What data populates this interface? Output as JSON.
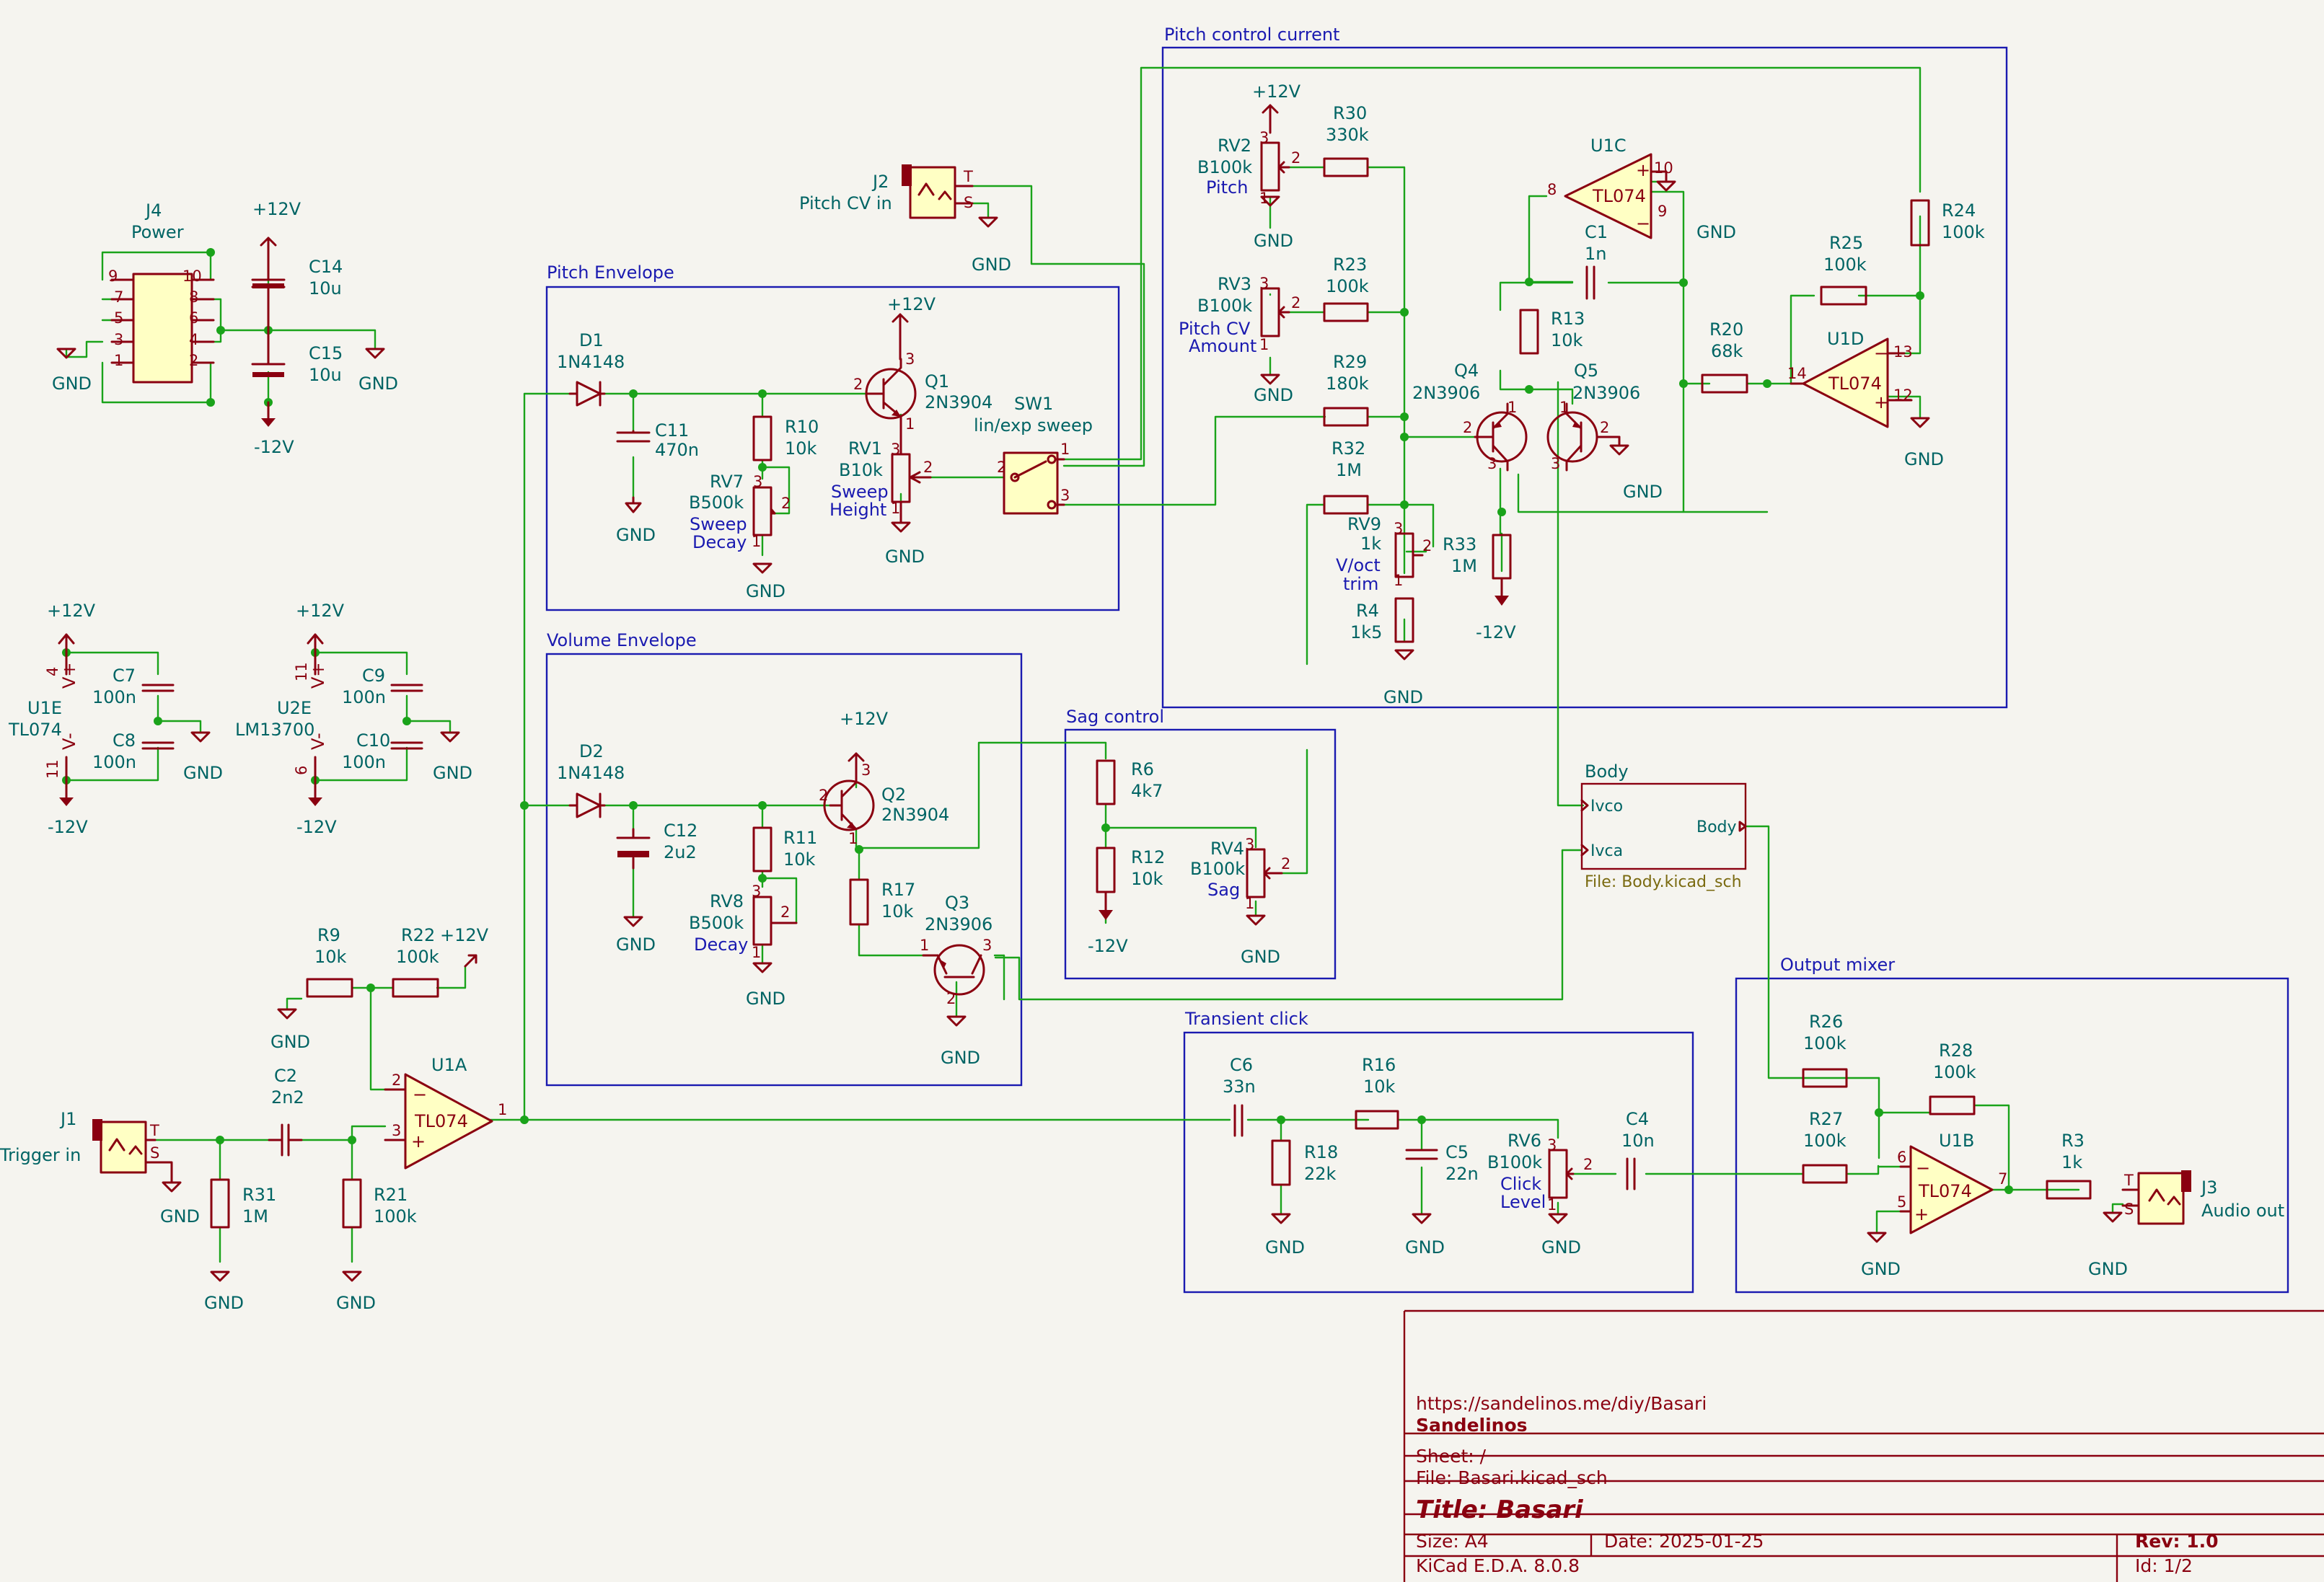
{
  "sheets": [
    {
      "key": "power",
      "title": "",
      "x": 0,
      "y": 0
    },
    {
      "key": "pitchenv",
      "title": "Pitch Envelope"
    },
    {
      "key": "pitchcur",
      "title": "Pitch control current"
    },
    {
      "key": "volenv",
      "title": "Volume Envelope"
    },
    {
      "key": "sag",
      "title": "Sag control"
    },
    {
      "key": "click",
      "title": "Transient click"
    },
    {
      "key": "mixer",
      "title": "Output mixer"
    }
  ],
  "sheet_titles": {
    "pitch_envelope": "Pitch Envelope",
    "pitch_control": "Pitch control current",
    "volume_envelope": "Volume Envelope",
    "sag_control": "Sag control",
    "transient_click": "Transient click",
    "output_mixer": "Output mixer"
  },
  "power": {
    "j4_ref": "J4",
    "j4_value": "Power",
    "j4_pins": [
      "9",
      "10",
      "7",
      "8",
      "5",
      "6",
      "3",
      "4",
      "1",
      "2"
    ],
    "c14_ref": "C14",
    "c14_value": "10u",
    "c15_ref": "C15",
    "c15_value": "10u",
    "gnd": "GND",
    "p12": "+12V",
    "m12": "-12V",
    "u1e_ref": "U1E",
    "u1e_value": "TL074",
    "u1e_p4": "4",
    "u1e_p11": "11",
    "u2e_ref": "U2E",
    "u2e_value": "LM13700",
    "u2e_p11": "11",
    "u2e_p6": "6",
    "vplus": "V+",
    "vminus": "V-",
    "c7_ref": "C7",
    "c7_value": "100n",
    "c8_ref": "C8",
    "c8_value": "100n",
    "c9_ref": "C9",
    "c9_value": "100n",
    "c10_ref": "C10",
    "c10_value": "100n"
  },
  "pitch_env": {
    "d1_ref": "D1",
    "d1_value": "1N4148",
    "c11_ref": "C11",
    "c11_value": "470n",
    "r10_ref": "R10",
    "r10_value": "10k",
    "rv7_ref": "RV7",
    "rv7_value": "B500k",
    "rv7_label": "Sweep\nDecay",
    "q1_ref": "Q1",
    "q1_value": "2N3904",
    "rv1_ref": "RV1",
    "rv1_value": "B10k",
    "rv1_label": "Sweep\nHeight",
    "sw1_ref": "SW1",
    "sw1_value": "lin/exp sweep",
    "j2_ref": "J2",
    "j2_value": "Pitch CV in"
  },
  "pitch_ctl": {
    "rv2_ref": "RV2",
    "rv2_value": "B100k",
    "rv2_label": "Pitch",
    "r30_ref": "R30",
    "r30_value": "330k",
    "rv3_ref": "RV3",
    "rv3_value": "B100k",
    "rv3_label": "Pitch CV\nAmount",
    "r23_ref": "R23",
    "r23_value": "100k",
    "r29_ref": "R29",
    "r29_value": "180k",
    "r32_ref": "R32",
    "r32_value": "1M",
    "rv9_ref": "RV9",
    "rv9_value": "1k",
    "rv9_label": "V/oct\ntrim",
    "r4_ref": "R4",
    "r4_value": "1k5",
    "r33_ref": "R33",
    "r33_value": "1M",
    "q4_ref": "Q4",
    "q4_value": "2N3906",
    "q5_ref": "Q5",
    "q5_value": "2N3906",
    "u1c_ref": "U1C",
    "u1c_value": "TL074",
    "c1_ref": "C1",
    "c1_value": "1n",
    "r13_ref": "R13",
    "r13_value": "10k",
    "r24_ref": "R24",
    "r24_value": "100k",
    "r25_ref": "R25",
    "r25_value": "100k",
    "r20_ref": "R20",
    "r20_value": "68k",
    "u1d_ref": "U1D",
    "u1d_value": "TL074"
  },
  "vol_env": {
    "d2_ref": "D2",
    "d2_value": "1N4148",
    "c12_ref": "C12",
    "c12_value": "2u2",
    "r11_ref": "R11",
    "r11_value": "10k",
    "rv8_ref": "RV8",
    "rv8_value": "B500k",
    "rv8_label": "Decay",
    "q2_ref": "Q2",
    "q2_value": "2N3904",
    "r17_ref": "R17",
    "r17_value": "10k",
    "q3_ref": "Q3",
    "q3_value": "2N3906"
  },
  "sag": {
    "r6_ref": "R6",
    "r6_value": "4k7",
    "r12_ref": "R12",
    "r12_value": "10k",
    "rv4_ref": "RV4",
    "rv4_value": "B100k",
    "rv4_label": "Sag"
  },
  "body": {
    "name": "Body",
    "file": "File: Body.kicad_sch",
    "pin_ivco": "Ivco",
    "pin_ivca": "Ivca",
    "pin_out": "Body"
  },
  "trigger": {
    "j1_ref": "J1",
    "j1_value": "Trigger in",
    "c2_ref": "C2",
    "c2_value": "2n2",
    "r31_ref": "R31",
    "r31_value": "1M",
    "r21_ref": "R21",
    "r21_value": "100k",
    "r9_ref": "R9",
    "r9_value": "10k",
    "r22_ref": "R22",
    "r22_value": "100k",
    "u1a_ref": "U1A",
    "u1a_value": "TL074"
  },
  "click": {
    "c6_ref": "C6",
    "c6_value": "33n",
    "r16_ref": "R16",
    "r16_value": "10k",
    "r18_ref": "R18",
    "r18_value": "22k",
    "c5_ref": "C5",
    "c5_value": "22n",
    "rv6_ref": "RV6",
    "rv6_value": "B100k",
    "rv6_label": "Click\nLevel",
    "c4_ref": "C4",
    "c4_value": "10n"
  },
  "mixer": {
    "r26_ref": "R26",
    "r26_value": "100k",
    "r27_ref": "R27",
    "r27_value": "100k",
    "r28_ref": "R28",
    "r28_value": "100k",
    "u1b_ref": "U1B",
    "u1b_value": "TL074",
    "r3_ref": "R3",
    "r3_value": "1k",
    "j3_ref": "J3",
    "j3_value": "Audio out"
  },
  "title_block": {
    "url": "https://sandelinos.me/diy/Basari",
    "company": "Sandelinos",
    "sheet": "Sheet: /",
    "file": "File: Basari.kicad_sch",
    "title": "Title: Basari",
    "size": "Size: A4",
    "date": "Date: 2025-01-25",
    "rev": "Rev: 1.0",
    "tool": "KiCad E.D.A. 8.0.8",
    "id": "Id: 1/2"
  }
}
